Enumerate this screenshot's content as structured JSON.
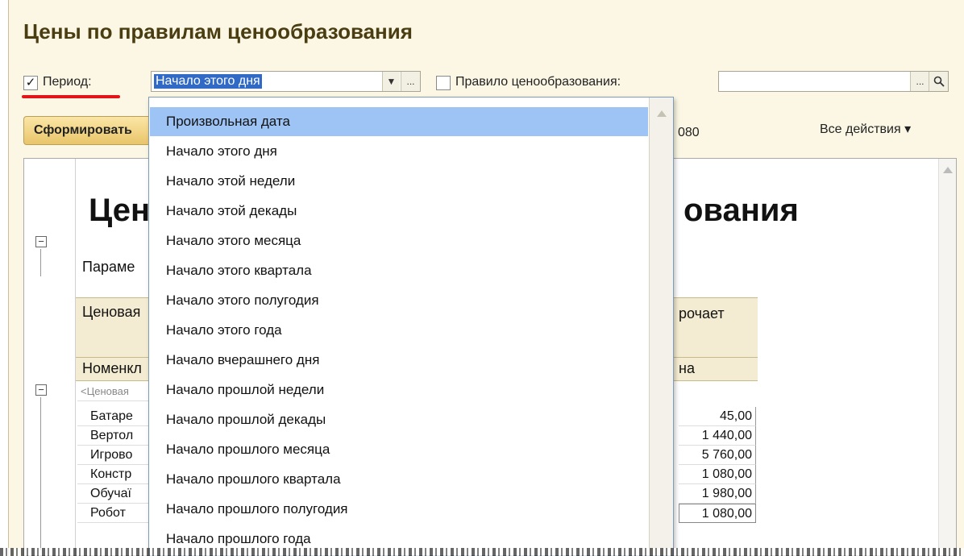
{
  "window": {
    "title": "Цены по правилам ценообразования"
  },
  "filters": {
    "period_label": "Период:",
    "period_checked_mark": "✓",
    "period_value": "Начало этого дня",
    "dropdown_arrow": "▼",
    "ellipsis": "...",
    "rule_label": "Правило ценообразования:",
    "rule_value": "",
    "search_glyph": "🔍"
  },
  "toolbar": {
    "generate_label": "Сформировать",
    "price_partial": "080",
    "all_actions_label": "Все действия ▾"
  },
  "report": {
    "title_left": "Цен",
    "title_right": "ования",
    "params_label": "Параме",
    "col_price_type": "Ценовая",
    "col_applies": "рочает",
    "col_nomenclature": "Номенкл",
    "col_price": "на",
    "group_row": "<Ценовая",
    "collapse_glyph": "−",
    "rows": [
      {
        "name": "Батаре",
        "price": "45,00"
      },
      {
        "name": "Вертол",
        "price": "1 440,00"
      },
      {
        "name": "Игрово",
        "price": "5 760,00"
      },
      {
        "name": "Констр",
        "price": "1 080,00"
      },
      {
        "name": "Обучаї",
        "price": "1 980,00"
      },
      {
        "name": "Робот ",
        "price": "1 080,00"
      }
    ]
  },
  "dropdown": {
    "items": [
      "Произвольная дата",
      "Начало этого дня",
      "Начало этой недели",
      "Начало этой декады",
      "Начало этого месяца",
      "Начало этого квартала",
      "Начало этого полугодия",
      "Начало этого года",
      "Начало вчерашнего дня",
      "Начало прошлой недели",
      "Начало прошлой декады",
      "Начало прошлого месяца",
      "Начало прошлого квартала",
      "Начало прошлого полугодия",
      "Начало прошлого года"
    ],
    "selected_index": 0
  },
  "colors": {
    "annotation_red": "#e4141b",
    "selection_blue": "#9dc4f5",
    "title_brown": "#4a3d12"
  }
}
